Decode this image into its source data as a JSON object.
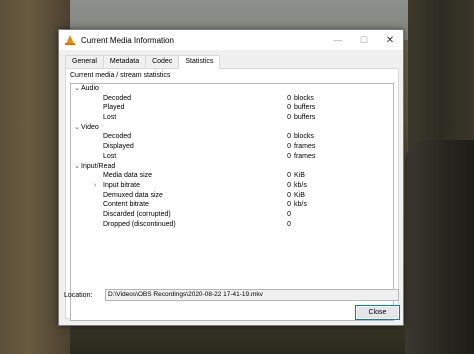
{
  "window": {
    "title": "Current Media Information",
    "minimize_glyph": "—",
    "maximize_glyph": "☐",
    "close_glyph": "✕"
  },
  "tabs": [
    {
      "label": "General",
      "active": false
    },
    {
      "label": "Metadata",
      "active": false
    },
    {
      "label": "Codec",
      "active": false
    },
    {
      "label": "Statistics",
      "active": true
    }
  ],
  "statistics": {
    "caption": "Current media / stream statistics",
    "audio": {
      "label": "Audio",
      "rows": [
        {
          "label": "Decoded",
          "value": "0",
          "unit": "blocks"
        },
        {
          "label": "Played",
          "value": "0",
          "unit": "buffers"
        },
        {
          "label": "Lost",
          "value": "0",
          "unit": "buffers"
        }
      ]
    },
    "video": {
      "label": "Video",
      "rows": [
        {
          "label": "Decoded",
          "value": "0",
          "unit": "blocks"
        },
        {
          "label": "Displayed",
          "value": "0",
          "unit": "frames"
        },
        {
          "label": "Lost",
          "value": "0",
          "unit": "frames"
        }
      ]
    },
    "input": {
      "label": "Input/Read",
      "rows": [
        {
          "label": "Media data size",
          "value": "0",
          "unit": "KiB"
        },
        {
          "label": "Input bitrate",
          "value": "0",
          "unit": "kb/s"
        },
        {
          "label": "Demuxed data size",
          "value": "0",
          "unit": "KiB"
        },
        {
          "label": "Content bitrate",
          "value": "0",
          "unit": "kb/s"
        },
        {
          "label": "Discarded (corrupted)",
          "value": "0",
          "unit": ""
        },
        {
          "label": "Dropped (discontinued)",
          "value": "0",
          "unit": ""
        }
      ]
    }
  },
  "location": {
    "label": "Location:",
    "value": "D:\\Videos\\OBS Recordings\\2020-08-22 17-41-19.mkv"
  },
  "buttons": {
    "close": "Close"
  }
}
